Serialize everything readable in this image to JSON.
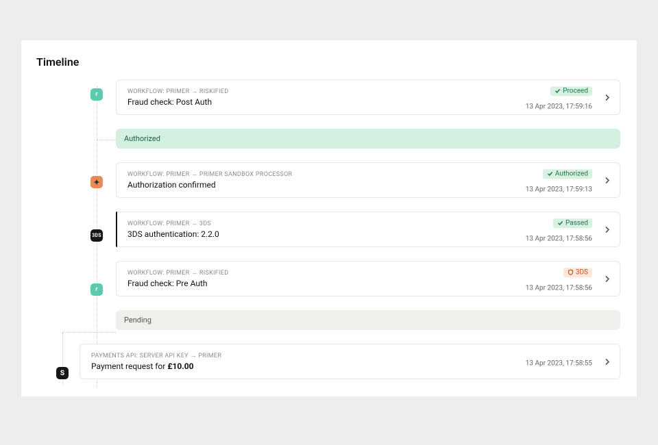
{
  "title": "Timeline",
  "statuses": {
    "authorized": "Authorized",
    "pending": "Pending"
  },
  "events": [
    {
      "workflow": "WORKFLOW: PRIMER → RISKIFIED",
      "title": "Fraud check: Post Auth",
      "badge_text": "Proceed",
      "badge_kind": "green",
      "timestamp": "13 Apr 2023, 17:59:16",
      "marker": "r-teal"
    },
    {
      "workflow": "WORKFLOW: PRIMER → PRIMER SANDBOX PROCESSOR",
      "title": "Authorization confirmed",
      "badge_text": "Authorized",
      "badge_kind": "green",
      "timestamp": "13 Apr 2023, 17:59:13",
      "marker": "orange"
    },
    {
      "workflow": "WORKFLOW: PRIMER → 3DS",
      "title": "3DS authentication: 2.2.0",
      "badge_text": "Passed",
      "badge_kind": "green",
      "timestamp": "13 Apr 2023, 17:58:56",
      "marker": "3ds-black"
    },
    {
      "workflow": "WORKFLOW: PRIMER → RISKIFIED",
      "title": "Fraud check: Pre Auth",
      "badge_text": "3DS",
      "badge_kind": "orange",
      "timestamp": "13 Apr 2023, 17:58:56",
      "marker": "r-teal"
    }
  ],
  "api_event": {
    "workflow": "PAYMENTS API: SERVER API KEY → PRIMER",
    "title_prefix": "Payment request for ",
    "amount": "£10.00",
    "timestamp": "13 Apr 2023, 17:58:55",
    "marker": "S"
  },
  "icons": {
    "check": "check-icon",
    "shield": "shield-icon",
    "chevron": "chevron-right-icon"
  }
}
